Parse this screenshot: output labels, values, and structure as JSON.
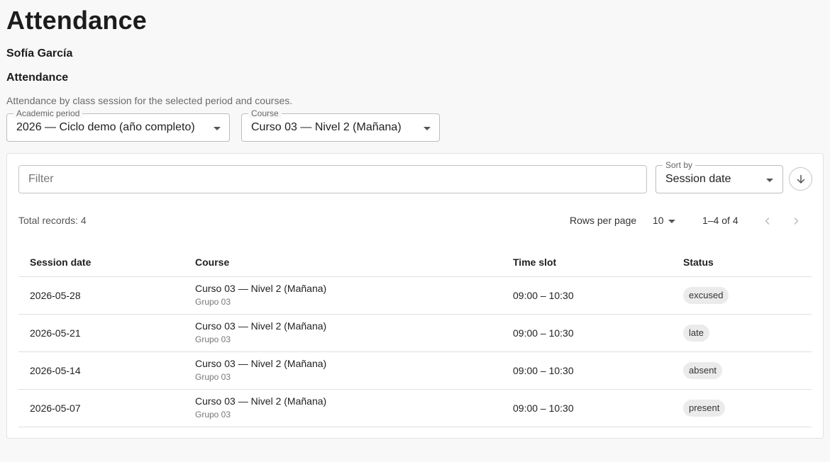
{
  "header": {
    "title": "Attendance",
    "student_name": "Sofía García",
    "section_title": "Attendance",
    "section_description": "Attendance by class session for the selected period and courses."
  },
  "filters": {
    "period": {
      "label": "Academic period",
      "value": "2026 — Ciclo demo (año completo)"
    },
    "course": {
      "label": "Course",
      "value": "Curso 03 — Nivel 2 (Mañana)"
    }
  },
  "toolbar": {
    "filter_placeholder": "Filter",
    "sort": {
      "label": "Sort by",
      "value": "Session date",
      "direction": "descending"
    }
  },
  "pagination": {
    "total_records": "Total records: 4",
    "rows_per_page_label": "Rows per page",
    "rows_per_page_value": "10",
    "range": "1–4 of 4"
  },
  "table": {
    "columns": [
      "Session date",
      "Course",
      "Time slot",
      "Status"
    ],
    "rows": [
      {
        "date": "2026-05-28",
        "course": "Curso 03 — Nivel 2 (Mañana)",
        "group": "Grupo 03",
        "time": "09:00 – 10:30",
        "status": "excused"
      },
      {
        "date": "2026-05-21",
        "course": "Curso 03 — Nivel 2 (Mañana)",
        "group": "Grupo 03",
        "time": "09:00 – 10:30",
        "status": "late"
      },
      {
        "date": "2026-05-14",
        "course": "Curso 03 — Nivel 2 (Mañana)",
        "group": "Grupo 03",
        "time": "09:00 – 10:30",
        "status": "absent"
      },
      {
        "date": "2026-05-07",
        "course": "Curso 03 — Nivel 2 (Mañana)",
        "group": "Grupo 03",
        "time": "09:00 – 10:30",
        "status": "present"
      }
    ]
  },
  "icons": {
    "select_caret": "caret-down-icon",
    "sort_direction": "arrow-down-icon",
    "prev": "chevron-left-icon",
    "next": "chevron-right-icon"
  },
  "colors": {
    "background": "#f8f8f8",
    "card": "#ffffff",
    "chip": "#ebebeb",
    "border": "#e0e0e0"
  }
}
